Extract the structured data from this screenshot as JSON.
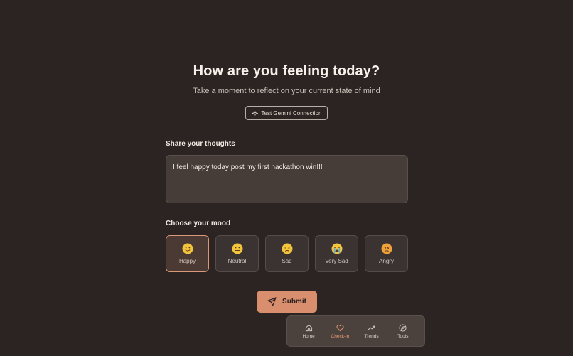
{
  "header": {
    "title": "How are you feeling today?",
    "subtitle": "Take a moment to reflect on your current state of mind",
    "test_button_label": "Test Gemini Connection"
  },
  "thoughts": {
    "label": "Share your thoughts",
    "value": "I feel happy today post my first hackathon win!!!"
  },
  "mood": {
    "label": "Choose your mood",
    "selected": "Happy",
    "options": [
      {
        "label": "Happy",
        "icon": "happy-emoji-icon"
      },
      {
        "label": "Neutral",
        "icon": "neutral-emoji-icon"
      },
      {
        "label": "Sad",
        "icon": "sad-emoji-icon"
      },
      {
        "label": "Very Sad",
        "icon": "very-sad-emoji-icon"
      },
      {
        "label": "Angry",
        "icon": "angry-emoji-icon"
      }
    ]
  },
  "submit": {
    "label": "Submit",
    "icon": "send-icon"
  },
  "nav": {
    "active": "Check-in",
    "items": [
      {
        "label": "Home",
        "icon": "home-icon"
      },
      {
        "label": "Check-in",
        "icon": "heart-icon"
      },
      {
        "label": "Trends",
        "icon": "trending-up-icon"
      },
      {
        "label": "Tools",
        "icon": "compass-icon"
      }
    ]
  },
  "colors": {
    "background": "#2c2422",
    "accent": "#d98e6e",
    "active_nav": "#e59a76",
    "emoji": "#f3c43c"
  }
}
